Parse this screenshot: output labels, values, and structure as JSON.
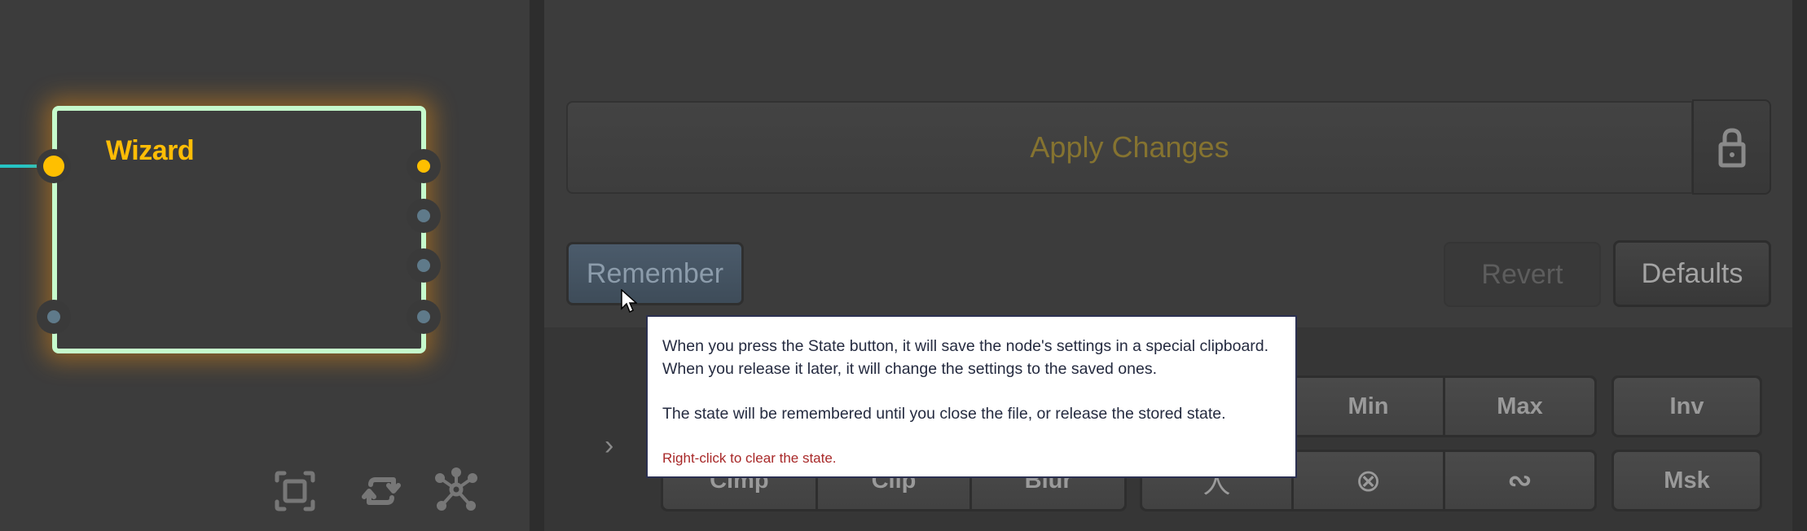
{
  "graph": {
    "node": {
      "title": "Wizard",
      "ports": {
        "inputs": [
          "main",
          "mask"
        ],
        "outputs": [
          "main",
          "out-2",
          "out-3",
          "out-4"
        ]
      }
    },
    "tools": [
      {
        "icon": "fit-view-icon"
      },
      {
        "icon": "swap-icon"
      },
      {
        "icon": "network-icon"
      }
    ],
    "colors": {
      "node_border": "#c6fbcc",
      "node_title": "#ffbd06",
      "wire": "#26c4c4",
      "port_active": "#ffbf00",
      "port_inactive": "#5f7a8a"
    }
  },
  "inspector": {
    "apply_label": "Apply Changes",
    "lock_icon": "lock-icon",
    "remember_label": "Remember",
    "revert_label": "Revert",
    "defaults_label": "Defaults",
    "expand_icon": "chevron-right-icon",
    "groups": {
      "left": {
        "row1": [
          "",
          "",
          ""
        ],
        "row2": [
          "Clmp",
          "Clip",
          "Blur"
        ]
      },
      "middle": {
        "row1": [
          "",
          "Min",
          "Max"
        ],
        "row2": [
          "人",
          "⊗",
          "∾"
        ]
      },
      "right": {
        "row1": [
          "Inv"
        ],
        "row2": [
          "Msk"
        ]
      }
    },
    "colors": {
      "apply_text": "#857330",
      "remember_bg": "#485868"
    }
  },
  "tooltip": {
    "line1": "When you press the State button, it will save the node's settings in a special clipboard.",
    "line2": "When you release it later, it will change the settings to the saved ones.",
    "line3": "The state will be remembered until you close the file, or release the stored state.",
    "hint": "Right-click to clear the state.",
    "hint_color": "#a82828"
  }
}
